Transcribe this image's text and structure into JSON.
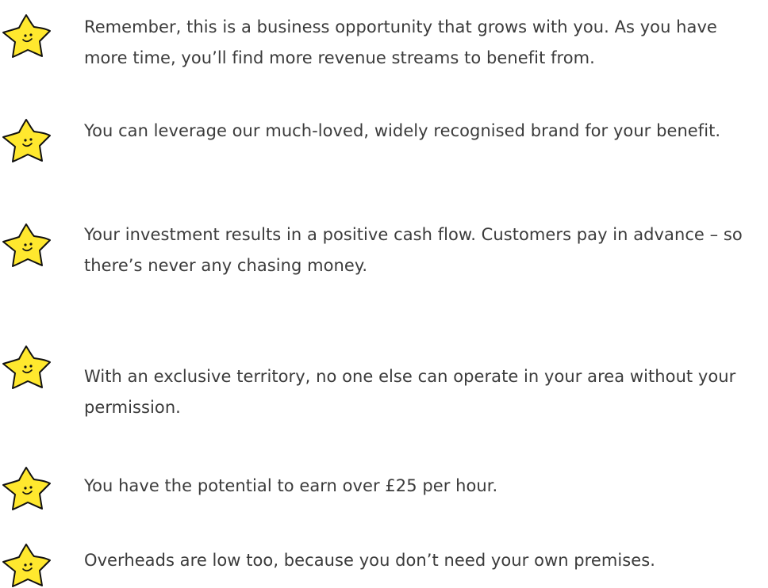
{
  "benefits": [
    {
      "icon": "smiling-star-icon",
      "text": "Remember, this is a business opportunity that grows with you. As you have more time, you’ll find more revenue streams to benefit from."
    },
    {
      "icon": "smiling-star-icon",
      "text": "You can leverage our much-loved, widely recognised brand for your benefit."
    },
    {
      "icon": "smiling-star-icon",
      "text": "Your investment results in a positive cash flow. Customers pay in advance – so there’s never any chasing money."
    },
    {
      "icon": "smiling-star-icon",
      "text": "With an exclusive territory, no one else can operate in your area without your permission."
    },
    {
      "icon": "smiling-star-icon",
      "text": "You have the potential to earn over £25 per hour."
    },
    {
      "icon": "smiling-star-icon",
      "text": "Overheads are low too, because you don’t need your own premises."
    }
  ],
  "colors": {
    "star_fill": "#FFE82E",
    "star_outline": "#111111",
    "text": "#3B3B3B",
    "background": "#FFFFFF"
  }
}
